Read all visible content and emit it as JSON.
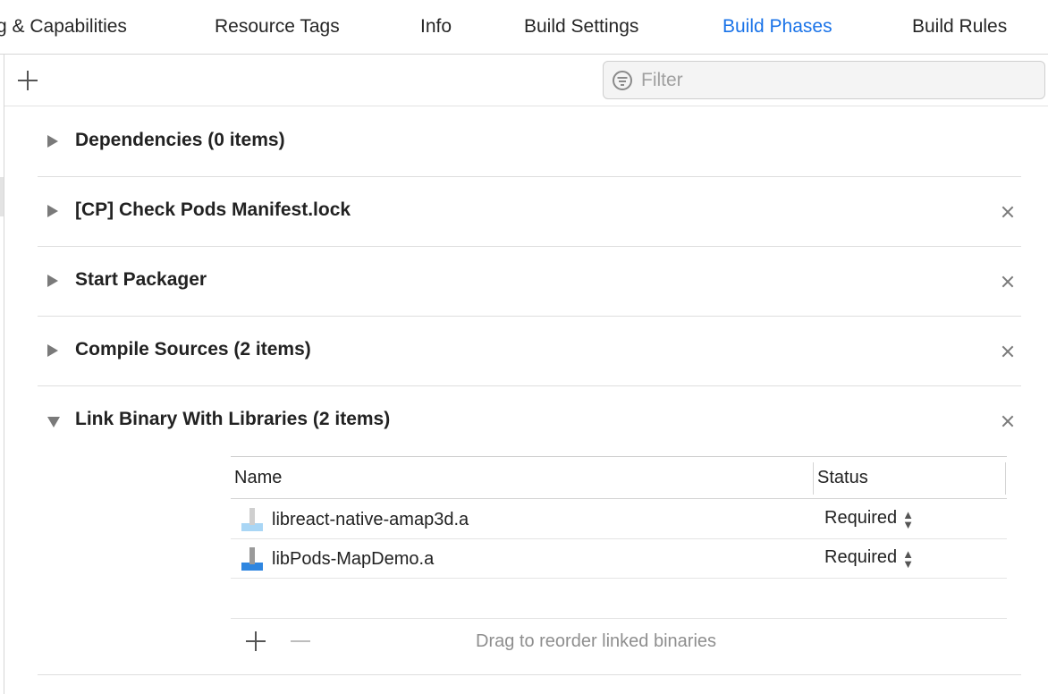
{
  "tabs": [
    {
      "label": "g & Capabilities",
      "active": false
    },
    {
      "label": "Resource Tags",
      "active": false
    },
    {
      "label": "Info",
      "active": false
    },
    {
      "label": "Build Settings",
      "active": false
    },
    {
      "label": "Build Phases",
      "active": true
    },
    {
      "label": "Build Rules",
      "active": false
    }
  ],
  "toolbar": {
    "filter_placeholder": "Filter"
  },
  "phases": [
    {
      "title": "Dependencies (0 items)",
      "expanded": false,
      "deletable": false
    },
    {
      "title": "[CP] Check Pods Manifest.lock",
      "expanded": false,
      "deletable": true
    },
    {
      "title": "Start Packager",
      "expanded": false,
      "deletable": true
    },
    {
      "title": "Compile Sources (2 items)",
      "expanded": false,
      "deletable": true
    },
    {
      "title": "Link Binary With Libraries (2 items)",
      "expanded": true,
      "deletable": true
    }
  ],
  "libraries": {
    "columns": {
      "name": "Name",
      "status": "Status"
    },
    "rows": [
      {
        "name": "libreact-native-amap3d.a",
        "status": "Required",
        "icon": "static-library-icon"
      },
      {
        "name": "libPods-MapDemo.a",
        "status": "Required",
        "icon": "static-library-icon"
      }
    ],
    "footer_hint": "Drag to reorder linked binaries"
  },
  "colors": {
    "accent": "#1a73e8",
    "text": "#222222",
    "muted": "#8e8e8e"
  }
}
